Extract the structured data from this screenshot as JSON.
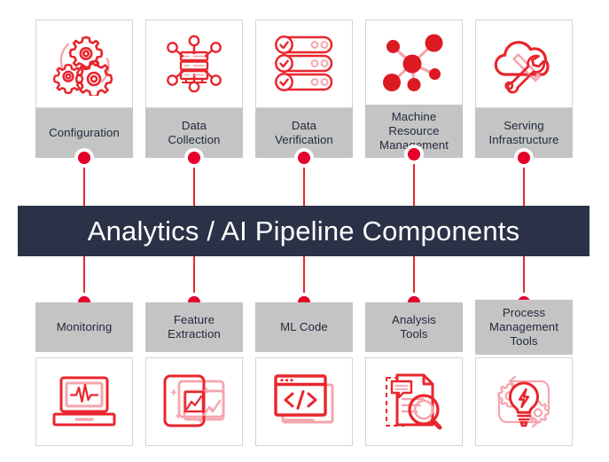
{
  "banner": {
    "title": "Analytics / AI Pipeline Components",
    "background_color": "#2b3247",
    "text_color": "#ffffff"
  },
  "theme": {
    "accent_red": "#e4002b",
    "icon_red": "#e8262d",
    "icon_red_light": "#f4a6ae",
    "label_background": "#c4c4c4",
    "label_text_color": "#222a3d",
    "card_border": "#d3d4d8",
    "page_background": "#ffffff"
  },
  "top_row": [
    {
      "label": "Configuration",
      "icon": "gears-icon"
    },
    {
      "label": "Data\nCollection",
      "icon": "server-network-icon"
    },
    {
      "label": "Data\nVerification",
      "icon": "checklist-icon"
    },
    {
      "label": "Machine\nResource\nManagement",
      "icon": "network-nodes-icon"
    },
    {
      "label": "Serving\nInfrastructure",
      "icon": "cloud-tools-icon"
    }
  ],
  "bottom_row": [
    {
      "label": "Monitoring",
      "icon": "laptop-pulse-icon"
    },
    {
      "label": "Feature\nExtraction",
      "icon": "image-stack-icon"
    },
    {
      "label": "ML Code",
      "icon": "code-window-icon"
    },
    {
      "label": "Analysis\nTools",
      "icon": "document-magnifier-icon"
    },
    {
      "label": "Process\nManagement\nTools",
      "icon": "lightbulb-gears-icon"
    }
  ]
}
